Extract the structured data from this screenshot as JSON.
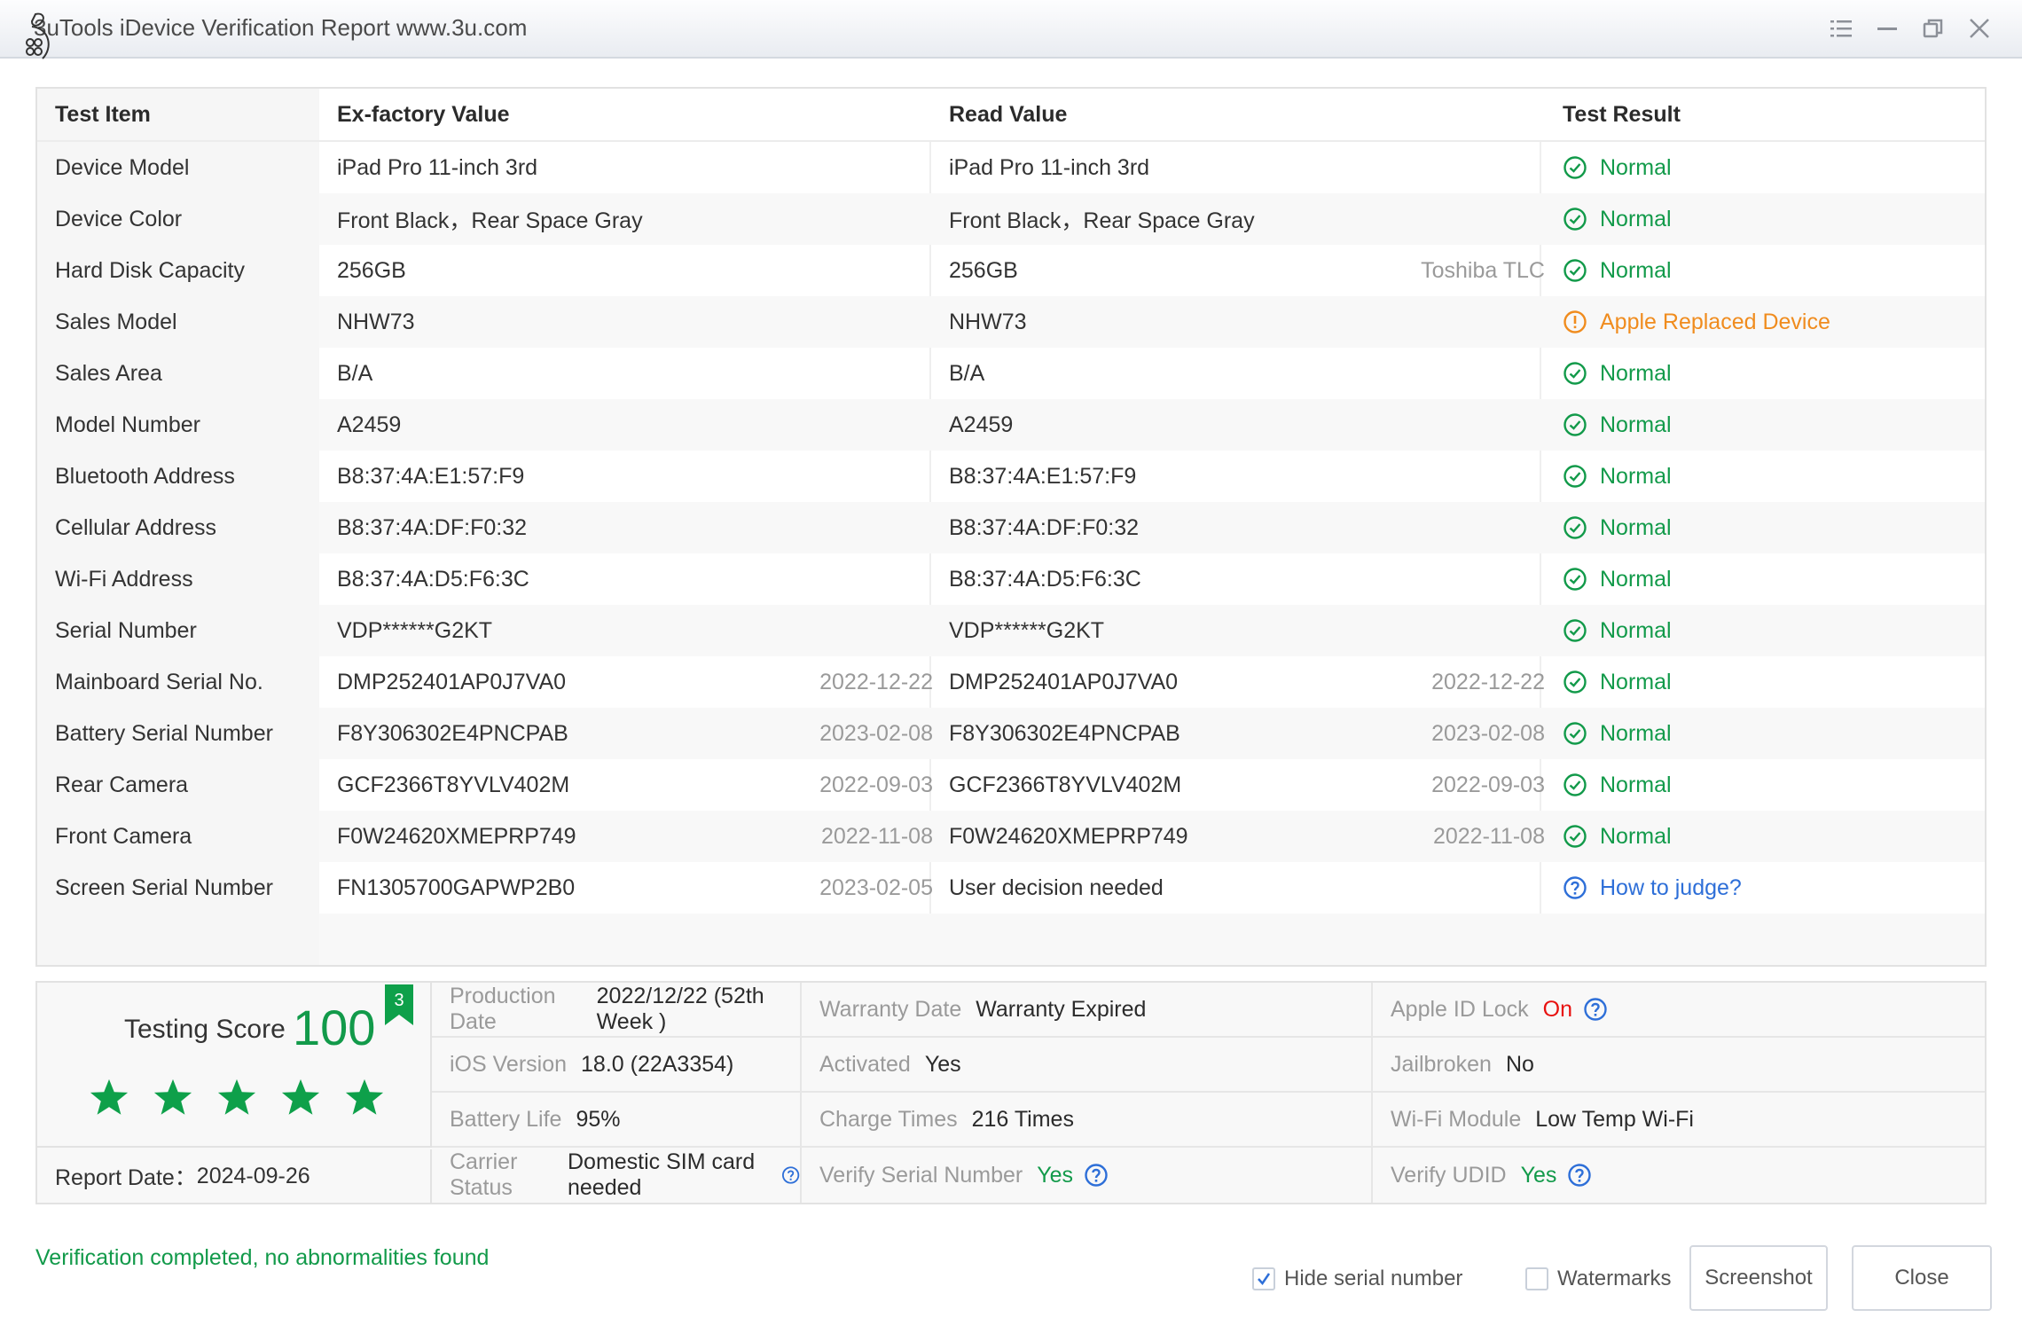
{
  "window": {
    "title": "3uTools iDevice Verification Report www.3u.com",
    "controls": [
      "menu",
      "minimize",
      "restore",
      "close"
    ]
  },
  "table": {
    "headers": [
      "Test Item",
      "Ex-factory Value",
      "Read Value",
      "Test Result"
    ],
    "rows": [
      {
        "item": "Device Model",
        "factory": "iPad Pro 11-inch 3rd",
        "factory_date": "",
        "read": "iPad Pro 11-inch 3rd",
        "read_extra": "",
        "result": "Normal",
        "status": "normal"
      },
      {
        "item": "Device Color",
        "factory": "Front Black，Rear Space Gray",
        "factory_date": "",
        "read": "Front Black，Rear Space Gray",
        "read_extra": "",
        "result": "Normal",
        "status": "normal"
      },
      {
        "item": "Hard Disk Capacity",
        "factory": "256GB",
        "factory_date": "",
        "read": "256GB",
        "read_extra": "Toshiba TLC",
        "result": "Normal",
        "status": "normal"
      },
      {
        "item": "Sales Model",
        "factory": "NHW73",
        "factory_date": "",
        "read": "NHW73",
        "read_extra": "",
        "result": "Apple Replaced Device",
        "status": "warn"
      },
      {
        "item": "Sales Area",
        "factory": "B/A",
        "factory_date": "",
        "read": "B/A",
        "read_extra": "",
        "result": "Normal",
        "status": "normal"
      },
      {
        "item": "Model Number",
        "factory": "A2459",
        "factory_date": "",
        "read": "A2459",
        "read_extra": "",
        "result": "Normal",
        "status": "normal"
      },
      {
        "item": "Bluetooth Address",
        "factory": "B8:37:4A:E1:57:F9",
        "factory_date": "",
        "read": "B8:37:4A:E1:57:F9",
        "read_extra": "",
        "result": "Normal",
        "status": "normal"
      },
      {
        "item": "Cellular Address",
        "factory": "B8:37:4A:DF:F0:32",
        "factory_date": "",
        "read": "B8:37:4A:DF:F0:32",
        "read_extra": "",
        "result": "Normal",
        "status": "normal"
      },
      {
        "item": "Wi-Fi Address",
        "factory": "B8:37:4A:D5:F6:3C",
        "factory_date": "",
        "read": "B8:37:4A:D5:F6:3C",
        "read_extra": "",
        "result": "Normal",
        "status": "normal"
      },
      {
        "item": "Serial Number",
        "factory": "VDP******G2KT",
        "factory_date": "",
        "read": "VDP******G2KT",
        "read_extra": "",
        "result": "Normal",
        "status": "normal"
      },
      {
        "item": "Mainboard Serial No.",
        "factory": "DMP252401AP0J7VA0",
        "factory_date": "2022-12-22",
        "read": "DMP252401AP0J7VA0",
        "read_extra": "2022-12-22",
        "result": "Normal",
        "status": "normal"
      },
      {
        "item": "Battery Serial Number",
        "factory": "F8Y306302E4PNCPAB",
        "factory_date": "2023-02-08",
        "read": "F8Y306302E4PNCPAB",
        "read_extra": "2023-02-08",
        "result": "Normal",
        "status": "normal"
      },
      {
        "item": "Rear Camera",
        "factory": "GCF2366T8YVLV402M",
        "factory_date": "2022-09-03",
        "read": "GCF2366T8YVLV402M",
        "read_extra": "2022-09-03",
        "result": "Normal",
        "status": "normal"
      },
      {
        "item": "Front Camera",
        "factory": "F0W24620XMEPRP749",
        "factory_date": "2022-11-08",
        "read": "F0W24620XMEPRP749",
        "read_extra": "2022-11-08",
        "result": "Normal",
        "status": "normal"
      },
      {
        "item": "Screen Serial Number",
        "factory": "FN1305700GAPWP2B0",
        "factory_date": "2023-02-05",
        "read": "User decision needed",
        "read_extra": "",
        "result": "How to judge?",
        "status": "link"
      }
    ]
  },
  "score": {
    "label": "Testing Score",
    "value": "100",
    "stars_filled": 5,
    "stars_total": 5,
    "badge": "3",
    "report_date_label": "Report Date：",
    "report_date": "2024-09-26"
  },
  "info": [
    [
      {
        "label": "Production Date",
        "value": "2022/12/22 (52th Week )",
        "tone": "normal",
        "help": false
      },
      {
        "label": "Warranty Date",
        "value": "Warranty Expired",
        "tone": "normal",
        "help": false
      },
      {
        "label": "Apple ID Lock",
        "value": "On",
        "tone": "red",
        "help": true
      }
    ],
    [
      {
        "label": "iOS Version",
        "value": "18.0 (22A3354)",
        "tone": "normal",
        "help": false
      },
      {
        "label": "Activated",
        "value": "Yes",
        "tone": "normal",
        "help": false
      },
      {
        "label": "Jailbroken",
        "value": "No",
        "tone": "normal",
        "help": false
      }
    ],
    [
      {
        "label": "Battery Life",
        "value": "95%",
        "tone": "normal",
        "help": false
      },
      {
        "label": "Charge Times",
        "value": "216 Times",
        "tone": "normal",
        "help": false
      },
      {
        "label": "Wi-Fi Module",
        "value": "Low Temp Wi-Fi",
        "tone": "normal",
        "help": false
      }
    ],
    [
      {
        "label": "Carrier Status",
        "value": "Domestic SIM card needed",
        "tone": "normal",
        "help": true
      },
      {
        "label": "Verify Serial Number",
        "value": "Yes",
        "tone": "green",
        "help": true
      },
      {
        "label": "Verify UDID",
        "value": "Yes",
        "tone": "green",
        "help": true
      }
    ]
  ],
  "footer": {
    "status_message": "Verification completed, no abnormalities found",
    "hide_serial_label": "Hide serial number",
    "hide_serial_checked": true,
    "watermarks_label": "Watermarks",
    "watermarks_checked": false,
    "screenshot_label": "Screenshot",
    "close_label": "Close"
  },
  "colors": {
    "normal": "#129a4a",
    "warn": "#f08c1e",
    "link": "#2e6fd8",
    "red": "#e8110f"
  }
}
